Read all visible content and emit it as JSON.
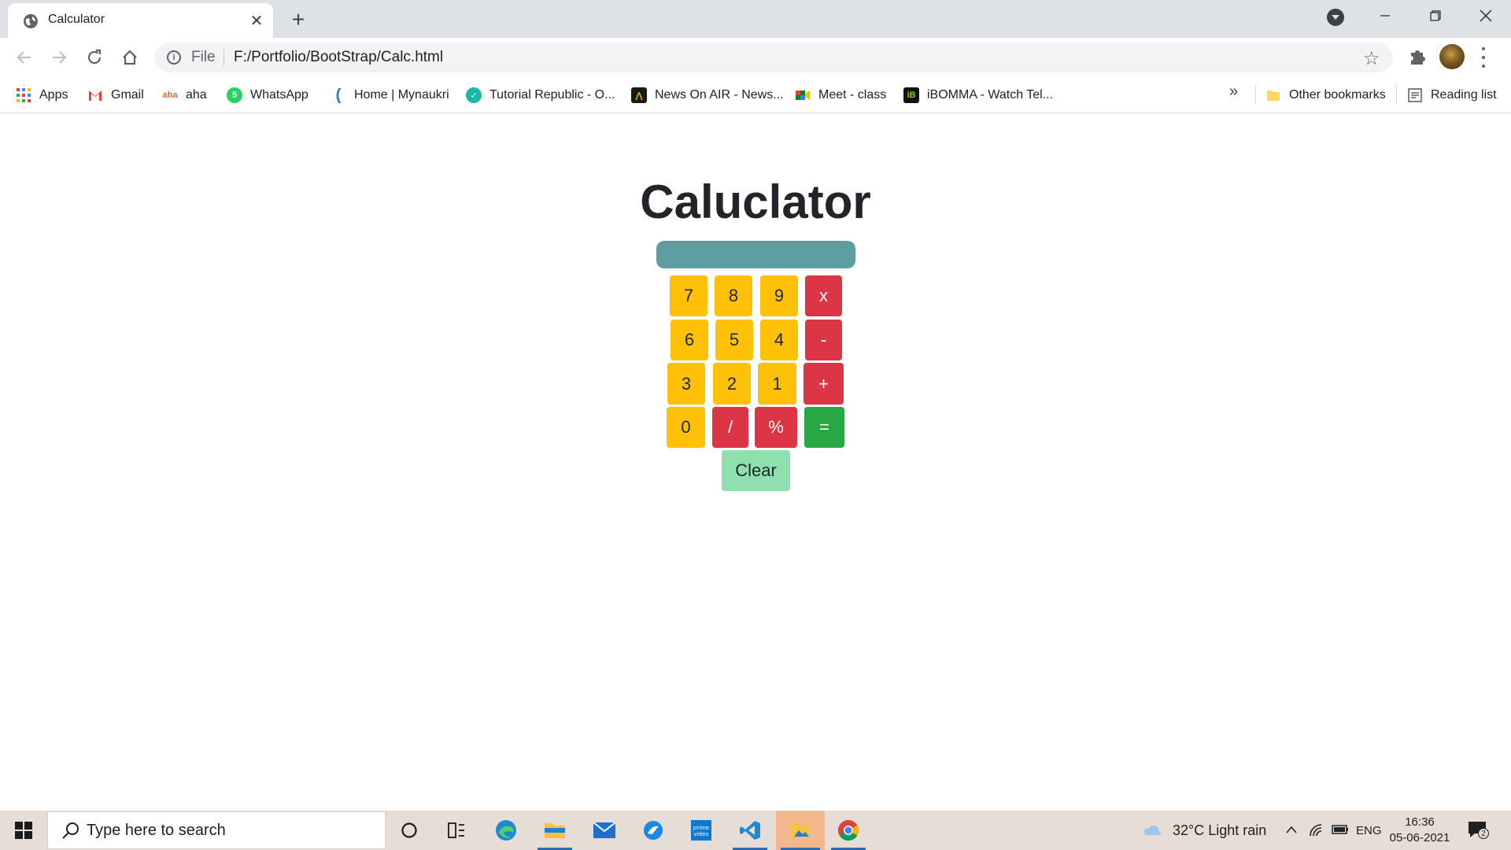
{
  "browser": {
    "tab_title": "Calculator",
    "address": {
      "scheme_label": "File",
      "url": "F:/Portfolio/BootStrap/Calc.html"
    },
    "bookmarks": [
      {
        "label": "Apps",
        "icon": "apps-grid-icon"
      },
      {
        "label": "Gmail",
        "icon": "gmail-icon"
      },
      {
        "label": "aha",
        "icon": "aha-icon"
      },
      {
        "label": "WhatsApp",
        "icon": "whatsapp-icon"
      },
      {
        "label": "Home | Mynaukri",
        "icon": "mynaukri-icon"
      },
      {
        "label": "Tutorial Republic - O...",
        "icon": "tutorial-republic-icon"
      },
      {
        "label": "News On AIR - News...",
        "icon": "news-on-air-icon"
      },
      {
        "label": "Meet - class",
        "icon": "meet-icon"
      },
      {
        "label": "iBOMMA - Watch Tel...",
        "icon": "ibomma-icon"
      }
    ],
    "more_bookmarks": "»",
    "other_bookmarks": "Other bookmarks",
    "reading_list": "Reading list"
  },
  "page": {
    "title": "Caluclator",
    "display_value": "",
    "keys": {
      "k7": "7",
      "k8": "8",
      "k9": "9",
      "mul": "x",
      "k6": "6",
      "k5": "5",
      "k4": "4",
      "sub": "-",
      "k3": "3",
      "k2": "2",
      "k1": "1",
      "add": "+",
      "k0": "0",
      "div": "/",
      "mod": "%",
      "eq": "=",
      "clear": "Clear"
    },
    "colors": {
      "digit": "#ffc107",
      "operator": "#dc3545",
      "equals": "#28a745",
      "clear": "#8fe0ae",
      "display": "#5f9ea0"
    }
  },
  "taskbar": {
    "search_placeholder": "Type here to search",
    "weather": "32°C  Light rain",
    "language": "ENG",
    "time": "16:36",
    "date": "05-06-2021",
    "notification_count": "2"
  }
}
